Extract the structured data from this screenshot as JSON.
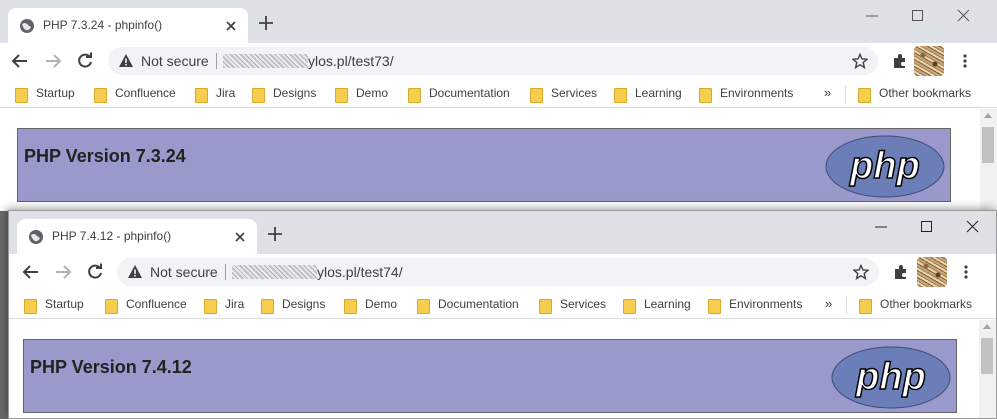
{
  "window1": {
    "tab_title": "PHP 7.3.24 - phpinfo()",
    "security_label": "Not secure",
    "url": "ylos.pl/test73/",
    "php_version": "PHP Version 7.3.24"
  },
  "window2": {
    "tab_title": "PHP 7.4.12 - phpinfo()",
    "security_label": "Not secure",
    "url": "ylos.pl/test74/",
    "php_version": "PHP Version 7.4.12"
  },
  "bookmarks": [
    "Startup",
    "Confluence",
    "Jira",
    "Designs",
    "Demo",
    "Documentation",
    "Services",
    "Learning",
    "Environments"
  ],
  "other_bookmarks": "Other bookmarks",
  "overflow_chevron": "»",
  "logo_text": "php",
  "colors": {
    "tabstrip": "#dee1e6",
    "php_header": "#9999cc",
    "php_logo": "#6c7eb7",
    "folder": "#f7cd4f"
  }
}
